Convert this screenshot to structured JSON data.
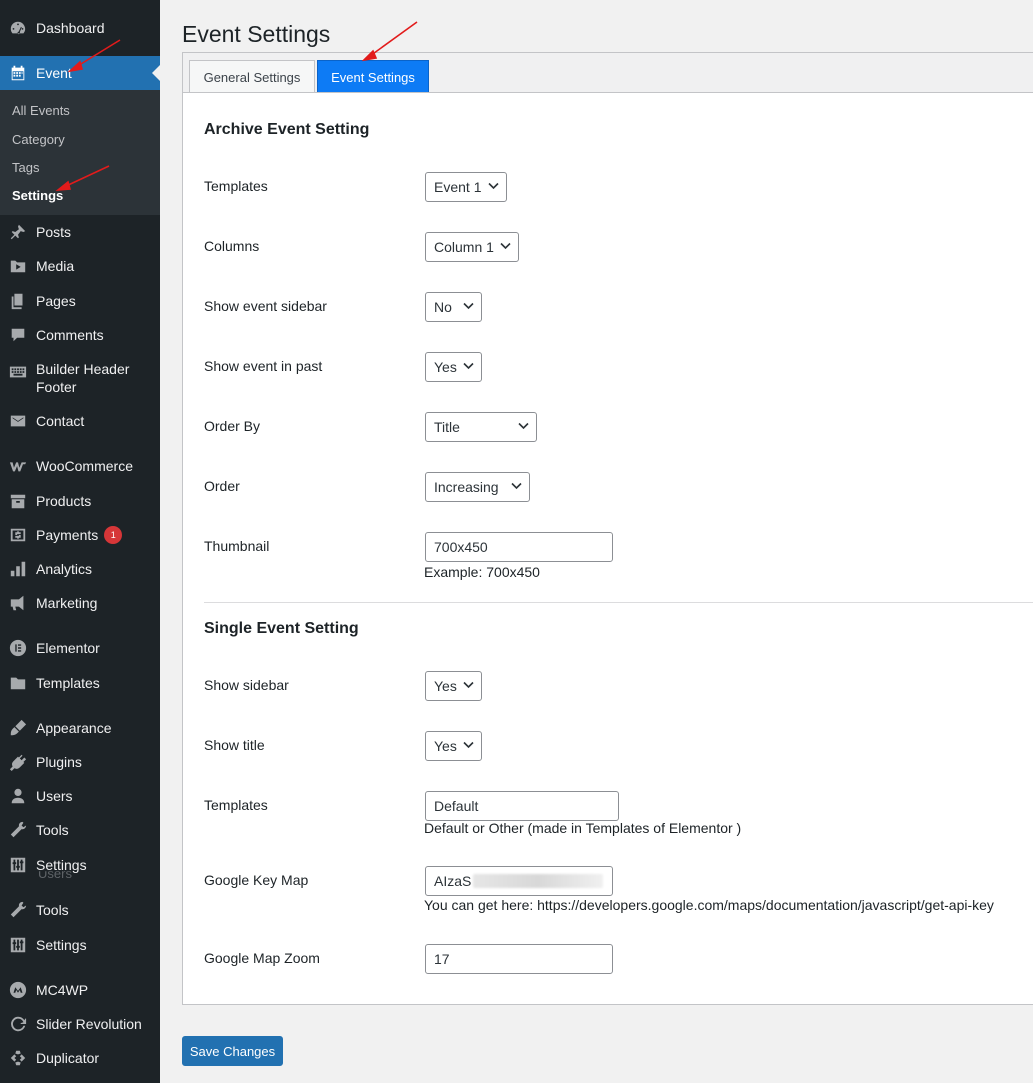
{
  "sidebar": {
    "items": [
      {
        "label": "Dashboard",
        "icon": "dashboard-icon"
      },
      {
        "label": "Event",
        "icon": "calendar-icon"
      },
      {
        "label": "Posts",
        "icon": "pin-icon"
      },
      {
        "label": "Media",
        "icon": "media-icon"
      },
      {
        "label": "Pages",
        "icon": "pages-icon"
      },
      {
        "label": "Comments",
        "icon": "comment-icon"
      },
      {
        "label": "Builder Header Footer",
        "icon": "keyboard-icon"
      },
      {
        "label": "Contact",
        "icon": "mail-icon"
      },
      {
        "label": "WooCommerce",
        "icon": "woocommerce-icon"
      },
      {
        "label": "Products",
        "icon": "archive-icon"
      },
      {
        "label": "Payments",
        "icon": "dollar-icon",
        "badge": "1"
      },
      {
        "label": "Analytics",
        "icon": "bar-chart-icon"
      },
      {
        "label": "Marketing",
        "icon": "megaphone-icon"
      },
      {
        "label": "Elementor",
        "icon": "elementor-icon"
      },
      {
        "label": "Templates",
        "icon": "folder-icon"
      },
      {
        "label": "Appearance",
        "icon": "brush-icon"
      },
      {
        "label": "Plugins",
        "icon": "plug-icon"
      },
      {
        "label": "Users",
        "icon": "user-icon"
      },
      {
        "label": "Tools",
        "icon": "wrench-icon"
      },
      {
        "label": "Settings",
        "icon": "sliders-icon"
      },
      {
        "label": "Tools",
        "icon": "wrench-icon"
      },
      {
        "label": "Settings",
        "icon": "sliders-icon"
      },
      {
        "label": "MC4WP",
        "icon": "mc4wp-icon"
      },
      {
        "label": "Slider Revolution",
        "icon": "refresh-icon"
      },
      {
        "label": "Duplicator",
        "icon": "duplicator-icon"
      }
    ],
    "submenu": [
      "All Events",
      "Category",
      "Tags",
      "Settings"
    ],
    "overlap_text": "Users"
  },
  "page": {
    "title": "Event Settings"
  },
  "tabs": {
    "general": "General Settings",
    "event": "Event Settings"
  },
  "archive": {
    "title": "Archive Event Setting",
    "templates_label": "Templates",
    "templates_value": "Event 1",
    "columns_label": "Columns",
    "columns_value": "Column 1",
    "sidebar_label": "Show event sidebar",
    "sidebar_value": "No",
    "past_label": "Show event in past",
    "past_value": "Yes",
    "orderby_label": "Order By",
    "orderby_value": "Title",
    "order_label": "Order",
    "order_value": "Increasing",
    "thumb_label": "Thumbnail",
    "thumb_value": "700x450",
    "thumb_help": "Example: 700x450"
  },
  "single": {
    "title": "Single Event Setting",
    "sidebar_label": "Show sidebar",
    "sidebar_value": "Yes",
    "title_label": "Show title",
    "title_value": "Yes",
    "templates_label": "Templates",
    "templates_value": "Default",
    "templates_help": "Default or Other (made in Templates of Elementor )",
    "mapkey_label": "Google Key Map",
    "mapkey_value": "AIzaS",
    "mapkey_help": "You can get here: https://developers.google.com/maps/documentation/javascript/get-api-key",
    "zoom_label": "Google Map Zoom",
    "zoom_value": "17"
  },
  "save_label": "Save Changes",
  "colors": {
    "accent": "#2271b1",
    "active_tab": "#0d7bf5",
    "sidebar_bg": "#1d2327",
    "arrow": "#e21b1b",
    "badge": "#d63638"
  }
}
